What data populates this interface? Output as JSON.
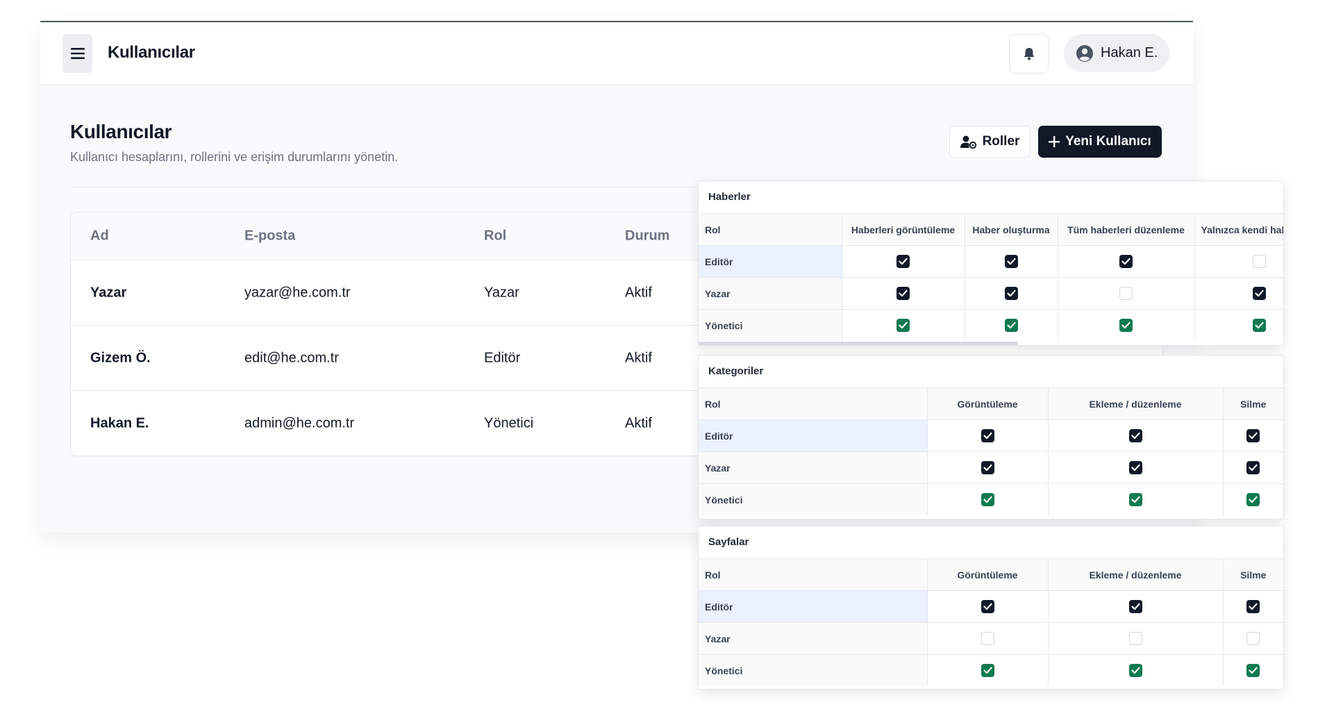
{
  "topbar": {
    "title": "Kullanıcılar",
    "menu_icon": "hamburger-menu-icon",
    "bell_icon": "bell-icon",
    "user_name": "Hakan E.",
    "user_icon": "user-circle-icon"
  },
  "header": {
    "title": "Kullanıcılar",
    "subtitle": "Kullanıcı hesaplarını, rollerini ve erişim durumlarını yönetin.",
    "roles_button": "Roller",
    "new_user_button": "Yeni Kullanıcı"
  },
  "users_table": {
    "columns": [
      "Ad",
      "E-posta",
      "Rol",
      "Durum"
    ],
    "rows": [
      {
        "name": "Yazar",
        "email": "yazar@he.com.tr",
        "role": "Yazar",
        "status": "Aktif"
      },
      {
        "name": "Gizem Ö.",
        "email": "edit@he.com.tr",
        "role": "Editör",
        "status": "Aktif"
      },
      {
        "name": "Hakan E.",
        "email": "admin@he.com.tr",
        "role": "Yönetici",
        "status": "Aktif"
      }
    ]
  },
  "permissions": {
    "haberler": {
      "title": "Haberler",
      "role_header": "Rol",
      "columns": [
        "Haberleri görüntüleme",
        "Haber oluşturma",
        "Tüm haberleri düzenleme",
        "Yalnızca kendi hab"
      ],
      "rows": [
        {
          "role": "Editör",
          "values": [
            "dark",
            "dark",
            "dark",
            "empty"
          ]
        },
        {
          "role": "Yazar",
          "values": [
            "dark",
            "dark",
            "empty",
            "dark"
          ]
        },
        {
          "role": "Yönetici",
          "values": [
            "green",
            "green",
            "green",
            "green"
          ]
        }
      ]
    },
    "kategoriler": {
      "title": "Kategoriler",
      "role_header": "Rol",
      "columns": [
        "Görüntüleme",
        "Ekleme / düzenleme",
        "Silme"
      ],
      "rows": [
        {
          "role": "Editör",
          "values": [
            "dark",
            "dark",
            "dark"
          ]
        },
        {
          "role": "Yazar",
          "values": [
            "dark",
            "dark",
            "dark"
          ]
        },
        {
          "role": "Yönetici",
          "values": [
            "green",
            "green",
            "green"
          ]
        }
      ]
    },
    "sayfalar": {
      "title": "Sayfalar",
      "role_header": "Rol",
      "columns": [
        "Görüntüleme",
        "Ekleme / düzenleme",
        "Silme"
      ],
      "rows": [
        {
          "role": "Editör",
          "values": [
            "dark",
            "dark",
            "dark"
          ]
        },
        {
          "role": "Yazar",
          "values": [
            "empty",
            "empty",
            "empty"
          ]
        },
        {
          "role": "Yönetici",
          "values": [
            "green",
            "green",
            "green"
          ]
        }
      ]
    }
  },
  "colors": {
    "primary": "#111827",
    "success": "#0f7a4f",
    "highlight": "#ebf1fe",
    "border": "#e5e7eb",
    "muted_text": "#6b7280"
  }
}
